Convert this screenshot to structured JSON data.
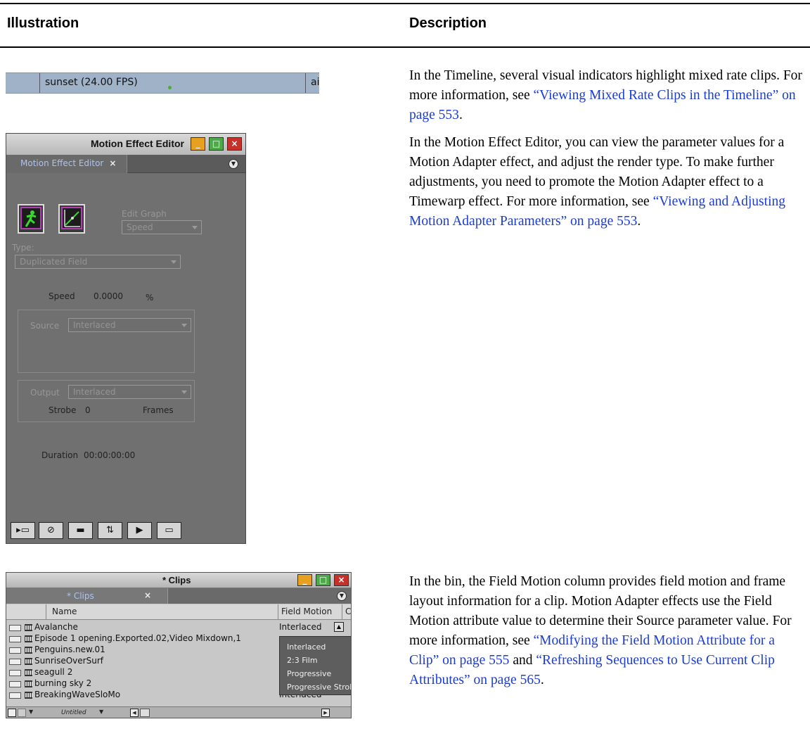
{
  "table_header": {
    "col_illustration": "Illustration",
    "col_description": "Description"
  },
  "rows": [
    {
      "description": "In the Timeline, several visual indicators highlight mixed rate clips. For more information, see ",
      "link": "“Viewing Mixed Rate Clips in the Timeline” on page 553",
      "tail": "."
    },
    {
      "description": "In the Motion Effect Editor, you can view the parameter values for a Motion Adapter effect, and adjust the render type. To make further adjustments, you need to promote the Motion Adapter effect to a Timewarp effect. For more information, see ",
      "link": "“Viewing and Adjusting Motion Adapter Parameters” on page 553",
      "tail": "."
    },
    {
      "description": "In the bin, the Field Motion column provides field motion and frame layout information for a clip. Motion Adapter effects use the Field Motion attribute value to determine their Source parameter value. For more information, see ",
      "link": "“Modifying the Field Motion Attribute for a Clip” on page 555",
      "mid": " and ",
      "link2": "“Refreshing Sequences to Use Current Clip Attributes” on page 565",
      "tail": "."
    }
  ],
  "timeline": {
    "clip_label": "sunset (24.00 FPS)",
    "next_clip": "airbo"
  },
  "motion_effect_editor": {
    "window_title": "Motion Effect Editor",
    "tab_label": "Motion Effect Editor",
    "tab_close": "×",
    "edit_graph_label": "Edit Graph",
    "edit_graph_value": "Speed",
    "type_label": "Type:",
    "type_value": "Duplicated Field",
    "speed_label": "Speed",
    "speed_value": "0.0000",
    "speed_unit": "%",
    "source_label": "Source",
    "source_value": "Interlaced",
    "output_label": "Output",
    "output_value": "Interlaced",
    "strobe_label": "Strobe",
    "strobe_value": "0",
    "strobe_unit": "Frames",
    "duration_label": "Duration",
    "duration_value": "00:00:00:00"
  },
  "bin": {
    "window_title": "* Clips",
    "tab_label": "* Clips",
    "tab_close": "×",
    "col_name": "Name",
    "col_field_motion": "Field Motion",
    "col_next": "C",
    "clips": [
      {
        "name": "Avalanche",
        "field_motion": "Interlaced"
      },
      {
        "name": "Episode 1 opening.Exported.02,Video Mixdown,1",
        "field_motion": ""
      },
      {
        "name": "Penguins.new.01",
        "field_motion": ""
      },
      {
        "name": "SunriseOverSurf",
        "field_motion": ""
      },
      {
        "name": "seagull 2",
        "field_motion": ""
      },
      {
        "name": "burning sky 2",
        "field_motion": ""
      },
      {
        "name": "BreakingWaveSloMo",
        "field_motion": "Interlaced"
      }
    ],
    "popup_options": [
      "Interlaced",
      "2:3 Film",
      "Progressive",
      "Progressive Strobe"
    ],
    "view_name": "Untitled"
  },
  "colors": {
    "link": "#1a3bd6",
    "timeline_bg": "#9fb2c8",
    "editor_bg": "#707070"
  }
}
